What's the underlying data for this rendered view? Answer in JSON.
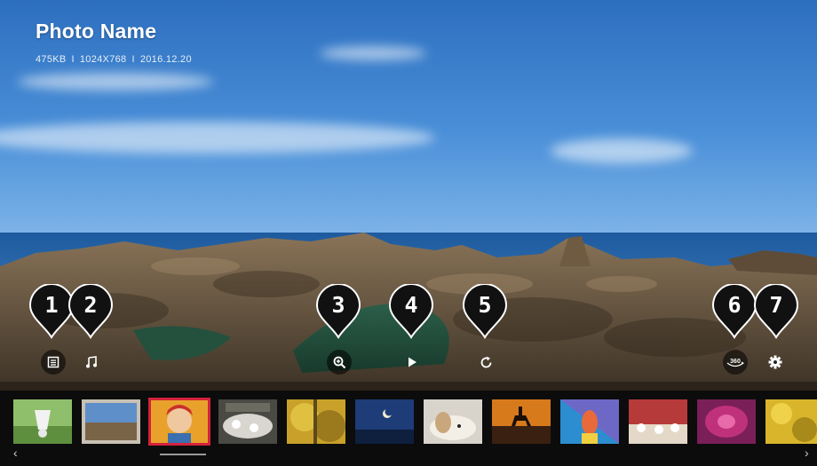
{
  "photo": {
    "title": "Photo Name",
    "size": "475KB",
    "resolution": "1024X768",
    "date": "2016.12.20",
    "separator": "I"
  },
  "controls": [
    {
      "callout": "1",
      "icon": "photo-list-icon"
    },
    {
      "callout": "2",
      "icon": "music-note-icon"
    },
    {
      "callout": "3",
      "icon": "zoom-in-icon"
    },
    {
      "callout": "4",
      "icon": "play-icon"
    },
    {
      "callout": "5",
      "icon": "rotate-icon"
    },
    {
      "callout": "6",
      "icon": "360-view-icon"
    },
    {
      "callout": "7",
      "icon": "gear-icon"
    }
  ],
  "thumbnails": [
    {
      "name": "badminton-shuttlecock",
      "selected": false
    },
    {
      "name": "coastal-rocks",
      "selected": false
    },
    {
      "name": "child-portrait",
      "selected": true
    },
    {
      "name": "dining-table",
      "selected": false
    },
    {
      "name": "golden-foliage",
      "selected": false
    },
    {
      "name": "moon-night-sky",
      "selected": false
    },
    {
      "name": "sleeping-dog",
      "selected": false
    },
    {
      "name": "horse-rider-sunset",
      "selected": false
    },
    {
      "name": "colorful-portrait",
      "selected": false
    },
    {
      "name": "red-dining-room",
      "selected": false
    },
    {
      "name": "pink-abstract",
      "selected": false
    },
    {
      "name": "yellow-leaves",
      "selected": false
    }
  ],
  "navigation": {
    "prev_icon": "chevron-left-icon",
    "next_icon": "chevron-right-icon"
  },
  "colors": {
    "selection": "#d3223b",
    "strip": "#0c0c0c",
    "callout": "#111111"
  }
}
